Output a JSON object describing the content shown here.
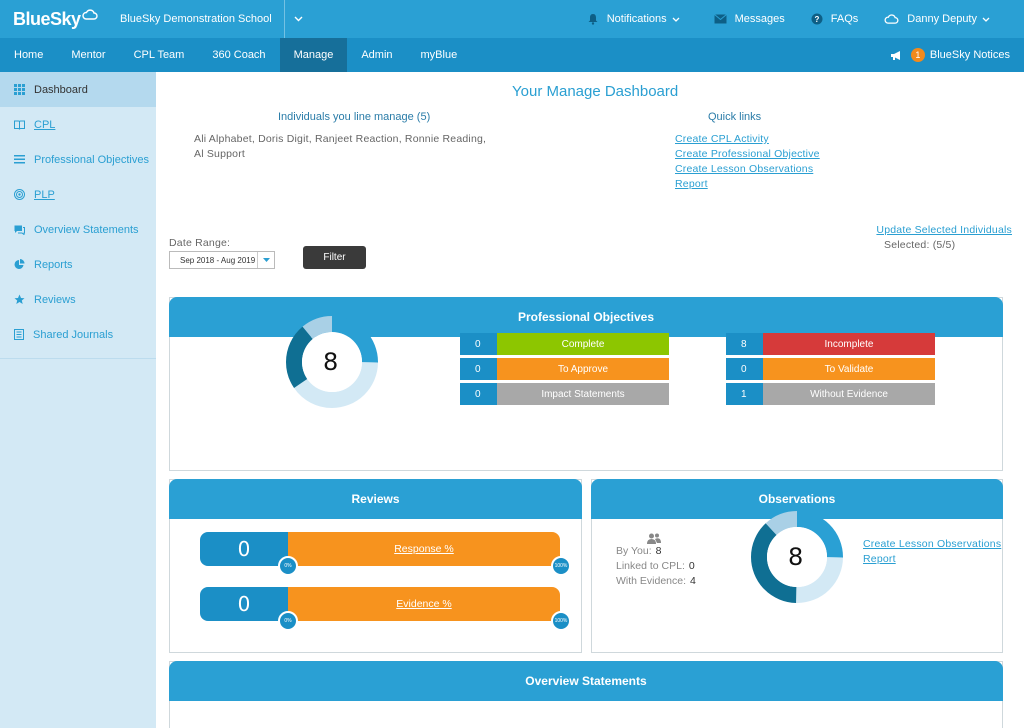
{
  "app": {
    "logo": "BlueSky",
    "school": "BlueSky Demonstration School"
  },
  "topbar": {
    "notifications": "Notifications",
    "messages": "Messages",
    "faqs": "FAQs",
    "user": "Danny Deputy"
  },
  "nav": {
    "items": [
      "Home",
      "Mentor",
      "CPL Team",
      "360 Coach",
      "Manage",
      "Admin",
      "myBlue"
    ],
    "active": "Manage",
    "notices_count": "1",
    "notices_label": "BlueSky Notices"
  },
  "sidebar": {
    "items": [
      {
        "label": "Dashboard",
        "icon": "grid-icon"
      },
      {
        "label": "CPL",
        "icon": "book-icon"
      },
      {
        "label": "Professional Objectives",
        "icon": "list-icon"
      },
      {
        "label": "PLP",
        "icon": "target-icon"
      },
      {
        "label": "Overview Statements",
        "icon": "chat-icon"
      },
      {
        "label": "Reports",
        "icon": "pie-icon"
      },
      {
        "label": "Reviews",
        "icon": "star-icon"
      },
      {
        "label": "Shared Journals",
        "icon": "journal-icon"
      }
    ]
  },
  "main": {
    "title": "Your Manage Dashboard",
    "individuals_heading": "Individuals you line manage (5)",
    "individuals_names": "Ali Alphabet, Doris Digit, Ranjeet Reaction, Ronnie Reading, Al Support",
    "quicklinks_heading": "Quick links",
    "quicklinks": [
      "Create CPL Activity",
      "Create Professional Objective",
      "Create Lesson Observations",
      "Report"
    ],
    "update_link": "Update Selected Individuals",
    "selected": "Selected: (5/5)",
    "date_range_label": "Date Range:",
    "date_range_value": "Sep 2018 - Aug 2019",
    "filter_label": "Filter"
  },
  "objectives": {
    "title": "Professional Objectives",
    "total": "8",
    "stats": [
      {
        "value": "0",
        "label": "Complete",
        "color": "#8dc600"
      },
      {
        "value": "0",
        "label": "To Approve",
        "color": "#f7931e"
      },
      {
        "value": "0",
        "label": "Impact Statements",
        "color": "#a8a8a8"
      },
      {
        "value": "8",
        "label": "Incomplete",
        "color": "#d63a3a"
      },
      {
        "value": "0",
        "label": "To Validate",
        "color": "#f7931e"
      },
      {
        "value": "1",
        "label": "Without Evidence",
        "color": "#a8a8a8"
      }
    ]
  },
  "reviews": {
    "title": "Reviews",
    "response_value": "0",
    "response_label": "Response %",
    "evidence_value": "0",
    "evidence_label": "Evidence %",
    "min_label": "0%",
    "max_label": "100%"
  },
  "observations": {
    "title": "Observations",
    "total": "8",
    "by_you_label": "By You:",
    "by_you": "8",
    "linked_label": "Linked to CPL:",
    "linked": "0",
    "evidence_label": "With Evidence:",
    "evidence": "4",
    "links": [
      "Create Lesson Observations",
      "Report"
    ]
  },
  "overview": {
    "title": "Overview Statements"
  }
}
